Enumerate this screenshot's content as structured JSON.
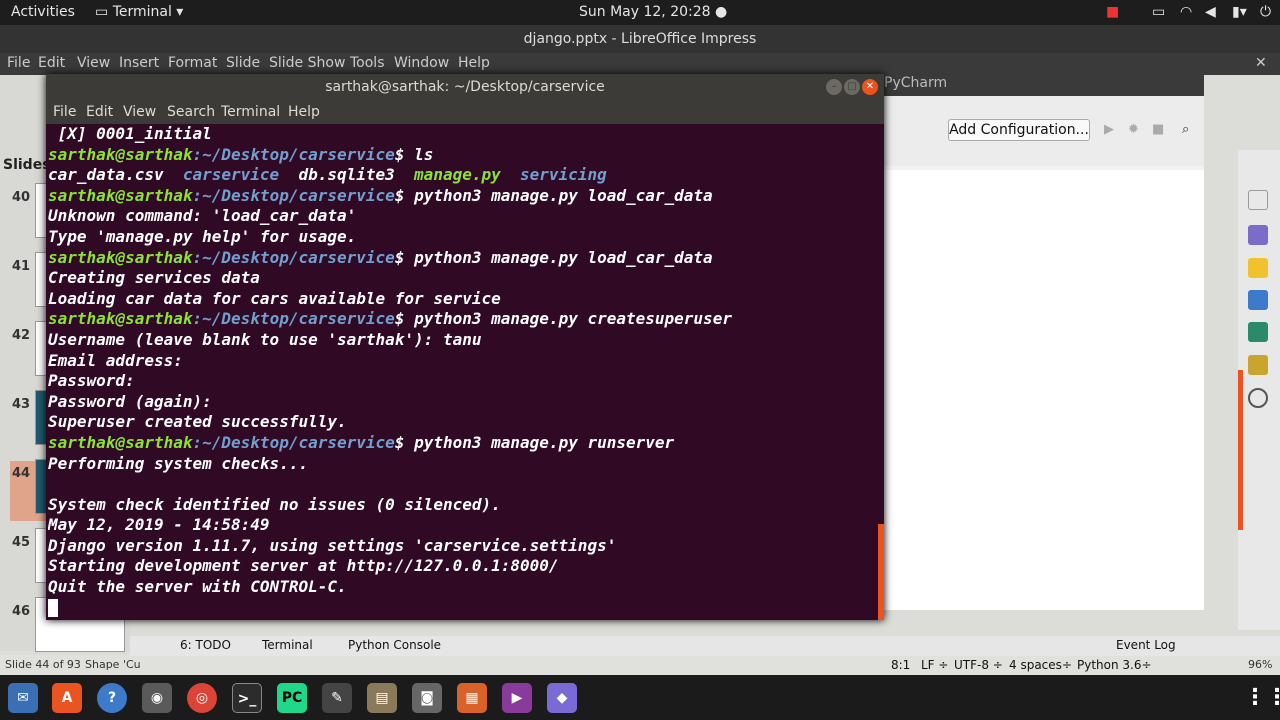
{
  "topbar": {
    "activities": "Activities",
    "app_menu": "Terminal",
    "clock": "Sun May 12, 20:28"
  },
  "impress": {
    "title": "django.pptx - LibreOffice Impress",
    "menu": [
      "File",
      "Edit",
      "View",
      "Insert",
      "Format",
      "Slide",
      "Slide Show",
      "Tools",
      "Window",
      "Help"
    ],
    "slides_label": "Slides",
    "slide_numbers": [
      "40",
      "41",
      "42",
      "43",
      "44",
      "45",
      "46"
    ],
    "status_slide": "Slide 44 of 93",
    "status_shape": "Shape 'Cu",
    "zoom": "96%"
  },
  "pycharm": {
    "title": "PyCharm",
    "add_configuration": "Add Configuration...",
    "tool_todo": "6: TODO",
    "tool_terminal": "Terminal",
    "tool_python_console": "Python Console",
    "event_log": "Event Log",
    "status_position": "8:1",
    "status_lf": "LF ÷",
    "status_encoding": "UTF-8 ÷",
    "status_indent": "4 spaces÷",
    "status_interpreter": "Python 3.6÷"
  },
  "terminal": {
    "title": "sarthak@sarthak: ~/Desktop/carservice",
    "menu": [
      "File",
      "Edit",
      "View",
      "Search",
      "Terminal",
      "Help"
    ],
    "prompt_user": "sarthak@sarthak",
    "prompt_path": ":~/Desktop/carservice",
    "lines": [
      {
        "type": "out",
        "text": " [X] 0001_initial"
      },
      {
        "type": "cmd",
        "cmd": " ls"
      },
      {
        "type": "ls",
        "files": [
          "car_data.csv",
          "carservice",
          "db.sqlite3",
          "manage.py",
          "servicing"
        ]
      },
      {
        "type": "cmd",
        "cmd": " python3 manage.py load_car_data"
      },
      {
        "type": "out",
        "text": "Unknown command: 'load_car_data'"
      },
      {
        "type": "out",
        "text": "Type 'manage.py help' for usage."
      },
      {
        "type": "cmd",
        "cmd": " python3 manage.py load_car_data"
      },
      {
        "type": "out",
        "text": "Creating services data"
      },
      {
        "type": "out",
        "text": "Loading car data for cars available for service"
      },
      {
        "type": "cmd",
        "cmd": " python3 manage.py createsuperuser"
      },
      {
        "type": "out",
        "text": "Username (leave blank to use 'sarthak'): tanu"
      },
      {
        "type": "out",
        "text": "Email address:"
      },
      {
        "type": "out",
        "text": "Password:"
      },
      {
        "type": "out",
        "text": "Password (again):"
      },
      {
        "type": "out",
        "text": "Superuser created successfully."
      },
      {
        "type": "cmd",
        "cmd": " python3 manage.py runserver"
      },
      {
        "type": "out",
        "text": "Performing system checks..."
      },
      {
        "type": "out",
        "text": ""
      },
      {
        "type": "out",
        "text": "System check identified no issues (0 silenced)."
      },
      {
        "type": "out",
        "text": "May 12, 2019 - 14:58:49"
      },
      {
        "type": "out",
        "text": "Django version 1.11.7, using settings 'carservice.settings'"
      },
      {
        "type": "out",
        "text": "Starting development server at http://127.0.0.1:8000/"
      },
      {
        "type": "out",
        "text": "Quit the server with CONTROL-C."
      }
    ]
  },
  "colors": {
    "terminal_bg": "#300a24",
    "prompt_user": "#8ae234",
    "prompt_path": "#729fcf",
    "accent": "#e95420"
  }
}
